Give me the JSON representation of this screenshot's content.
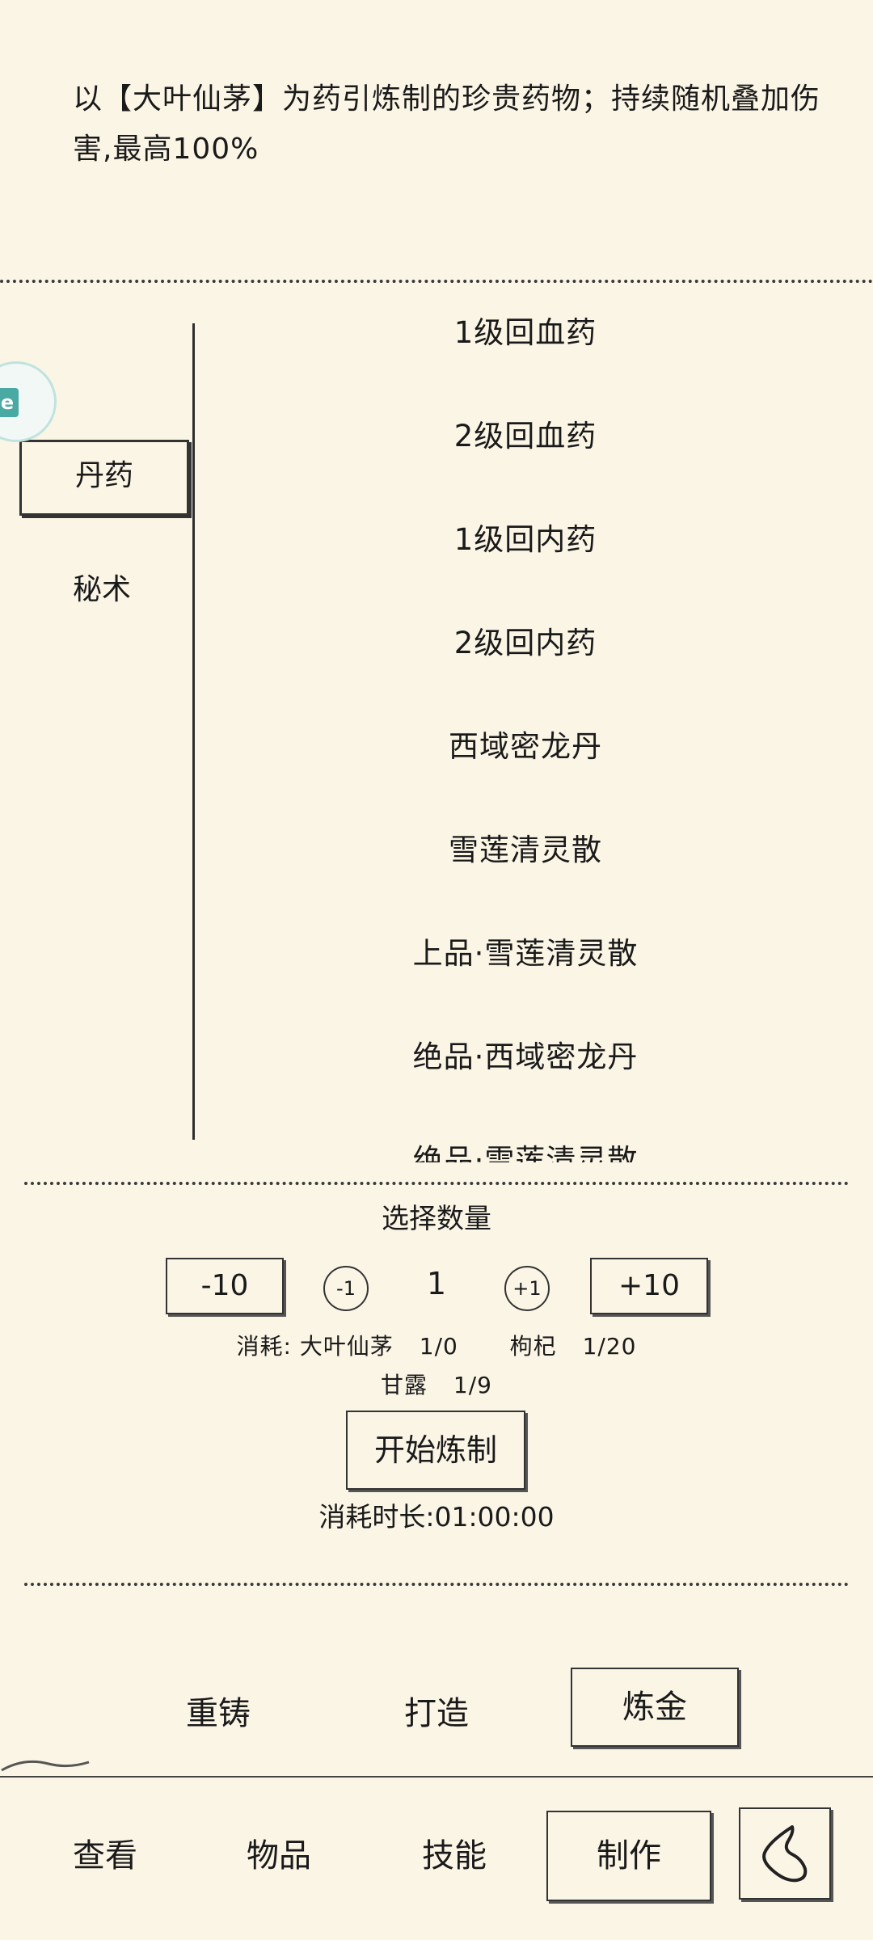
{
  "description": "以【大叶仙茅】为药引炼制的珍贵药物；持续随机叠加伤害,最高100%",
  "categories": [
    {
      "label": "丹药",
      "selected": true
    },
    {
      "label": "秘术",
      "selected": false
    }
  ],
  "recipes": [
    "1级回血药",
    "2级回血药",
    "1级回内药",
    "2级回内药",
    "西域密龙丹",
    "雪莲清灵散",
    "上品·雪莲清灵散",
    "绝品·西域密龙丹",
    "绝品·雪莲清灵散"
  ],
  "quantity": {
    "title": "选择数量",
    "minus10": "-10",
    "minus1": "-1",
    "value": "1",
    "plus1": "+1",
    "plus10": "+10"
  },
  "consume": {
    "prefix": "消耗:",
    "materials": [
      {
        "name": "大叶仙茅",
        "count": "1/0"
      },
      {
        "name": "枸杞",
        "count": "1/20"
      },
      {
        "name": "甘露",
        "count": "1/9"
      }
    ]
  },
  "craft_button": "开始炼制",
  "duration": "消耗时长:01:00:00",
  "craft_tabs": [
    {
      "label": "重铸",
      "selected": false
    },
    {
      "label": "打造",
      "selected": false
    },
    {
      "label": "炼金",
      "selected": true
    }
  ],
  "bottom_nav": [
    {
      "label": "查看",
      "selected": false
    },
    {
      "label": "物品",
      "selected": false
    },
    {
      "label": "技能",
      "selected": false
    },
    {
      "label": "制作",
      "selected": true
    }
  ],
  "icons": {
    "back": "back-arrow-icon",
    "badge": "floating-assistant-icon"
  }
}
